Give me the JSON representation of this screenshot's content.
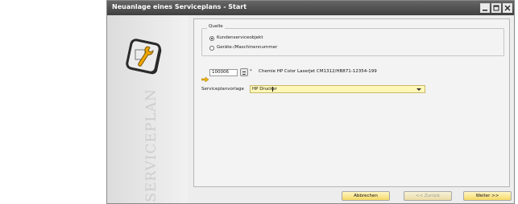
{
  "window": {
    "title": "Neuanlage eines Serviceplans - Start"
  },
  "sidebar": {
    "vertical_text": "SERVICEPLAN",
    "icon": "wrench-icon"
  },
  "source_group": {
    "label": "Quelle",
    "options": [
      {
        "label": "Kundenserviceobjekt",
        "selected": true
      },
      {
        "label": "Geräte-/Maschinennummer",
        "selected": false
      }
    ]
  },
  "service_object": {
    "value": "100006",
    "description": "Chemie HP Color LaserJet CM1312/HB871-12354-199"
  },
  "template": {
    "label": "Serviceplanvorlage",
    "value": "HP Drucker"
  },
  "buttons": {
    "cancel": "Abbrechen",
    "back": "<< Zurück",
    "next": "Weiter >>"
  },
  "colors": {
    "titlebar": "#4a4a4a",
    "field_highlight": "#fff7b8",
    "button": "#f5d966"
  }
}
